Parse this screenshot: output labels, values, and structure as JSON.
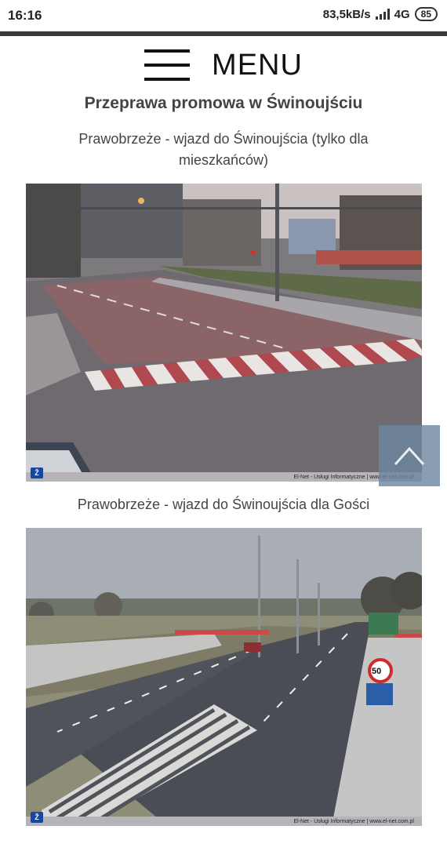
{
  "status_bar": {
    "time": "16:16",
    "network_speed": "83,5kB/s",
    "network_type": "4G",
    "battery": "85"
  },
  "menu": {
    "label": "MENU",
    "icon": "hamburger-icon"
  },
  "page_title": "Przeprawa promowa w Świnoujściu",
  "cameras": [
    {
      "title": "Prawobrzeże - wjazd do Świnoujścia (tylko dla mieszkańców)",
      "watermark": "El-Net - Usługi Informatyczne | www.el-net.com.pl"
    },
    {
      "title": "Prawobrzeże - wjazd do Świnoujścia dla Gości",
      "watermark": "El-Net - Usługi Informatyczne | www.el-net.com.pl",
      "speed_sign": "50"
    }
  ],
  "scroll_top": {
    "icon": "chevron-up-icon"
  }
}
